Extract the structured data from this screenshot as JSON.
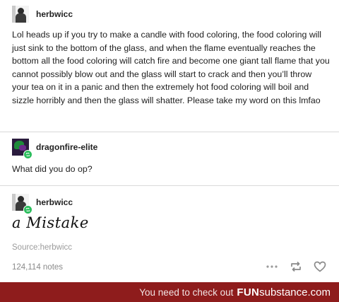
{
  "posts": [
    {
      "username": "herbwicc",
      "text": "Lol heads up if you try to make a candle with food coloring, the food coloring will just sink to the bottom of the glass, and when the flame eventually reaches the bottom all the food coloring will catch fire and become one giant tall flame that you cannot possibly blow out and the glass will start to crack and then you’ll throw your tea on it in a panic and then the extremely hot food coloring will boil and sizzle horribly and then the glass will shatter. Please take my word on this lmfao"
    },
    {
      "username": "dragonfire-elite",
      "text": "What did you do op?"
    },
    {
      "username": "herbwicc",
      "text": "a Mistake"
    }
  ],
  "source": "Source:herbwicc",
  "notes": "124,114 notes",
  "icons": {
    "more": "more-icon",
    "reblog": "reblog-icon",
    "like": "heart-icon"
  },
  "banner": {
    "text": "You need to check out",
    "brand_bold": "FUN",
    "brand_rest": "substance.com"
  },
  "colors": {
    "banner": "#8e1c1c",
    "reblog_badge": "#2bbd5c"
  }
}
